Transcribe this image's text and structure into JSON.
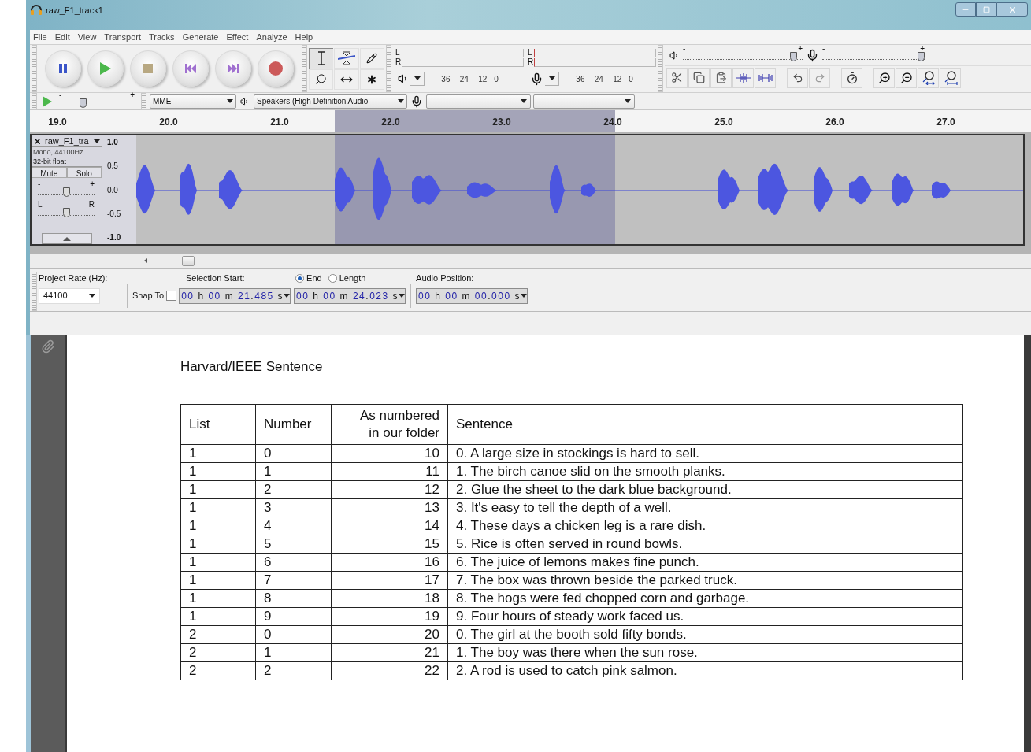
{
  "window": {
    "title": "raw_F1_track1"
  },
  "menu": [
    "File",
    "Edit",
    "View",
    "Transport",
    "Tracks",
    "Generate",
    "Effect",
    "Analyze",
    "Help"
  ],
  "tools": [
    {
      "kind": "select",
      "selected": true
    },
    {
      "kind": "envelope",
      "selected": false
    },
    {
      "kind": "draw",
      "selected": false
    },
    {
      "kind": "zoom",
      "selected": false
    },
    {
      "kind": "timeshift",
      "selected": false
    },
    {
      "kind": "multi",
      "selected": false
    }
  ],
  "meters": [
    {
      "kind": "playback",
      "channels": [
        "L",
        "R"
      ],
      "scale": [
        "-36",
        "-24",
        "-12",
        "0"
      ]
    },
    {
      "kind": "recording",
      "channels": [
        "L",
        "R"
      ],
      "scale": [
        "-36",
        "-24",
        "-12",
        "0"
      ]
    }
  ],
  "mixer": [
    {
      "kind": "output",
      "min": "-",
      "max": "+",
      "level": 0.95
    },
    {
      "kind": "input",
      "min": "-",
      "max": "+",
      "level": 1
    }
  ],
  "play_at_speed": {
    "min": "-",
    "max": "+",
    "level": 0.3
  },
  "devices": {
    "host": "MME",
    "output": "Speakers (High Definition Audio"
  },
  "ruler": [
    "19.0",
    "20.0",
    "21.0",
    "22.0",
    "23.0",
    "24.0",
    "25.0",
    "26.0",
    "27.0"
  ],
  "track": {
    "name": "raw_F1_tra",
    "format": "Mono, 44100Hz",
    "sample": "32-bit float",
    "mute": "Mute",
    "solo": "Solo",
    "gain": {
      "min": "-",
      "max": "+",
      "level": 0.5
    },
    "pan": {
      "min": "L",
      "max": "R",
      "level": 0.5
    },
    "scale": [
      "1.0",
      "0.5",
      "0.0",
      "-0.5",
      "-1.0"
    ]
  },
  "selection_bar": {
    "rate_label": "Project Rate (Hz):",
    "rate": "44100",
    "snap_label": "Snap To",
    "snap": false,
    "start_label": "Selection Start:",
    "modes": [
      {
        "label": "End",
        "selected": true
      },
      {
        "label": "Length",
        "selected": false
      }
    ],
    "start": "00 h 00 m 21.485 s",
    "end": "00 h 00 m 24.023 s",
    "position_label": "Audio Position:",
    "position": "00 h 00 m 00.000 s"
  },
  "document": {
    "heading": "Harvard/IEEE Sentence",
    "table": {
      "columns": [
        "List",
        "Number",
        "As numbered in our folder",
        "Sentence"
      ],
      "rows": [
        [
          "1",
          "0",
          "10",
          "0. A large size in stockings is hard to sell."
        ],
        [
          "1",
          "1",
          "11",
          "1. The birch canoe slid on the smooth planks."
        ],
        [
          "1",
          "2",
          "12",
          "2. Glue the sheet to the dark blue background."
        ],
        [
          "1",
          "3",
          "13",
          "3. It's easy to tell the depth of a well."
        ],
        [
          "1",
          "4",
          "14",
          "4. These days a chicken leg is a rare dish."
        ],
        [
          "1",
          "5",
          "15",
          "5. Rice is often served in round bowls."
        ],
        [
          "1",
          "6",
          "16",
          "6. The juice of lemons makes fine punch."
        ],
        [
          "1",
          "7",
          "17",
          "7. The box was thrown beside the parked truck."
        ],
        [
          "1",
          "8",
          "18",
          "8. The hogs were fed chopped corn and garbage."
        ],
        [
          "1",
          "9",
          "19",
          "9. Four hours of steady work faced us."
        ],
        [
          "2",
          "0",
          "20",
          "0. The girl at the booth sold fifty bonds."
        ],
        [
          "2",
          "1",
          "21",
          "1. The boy was there when the sun rose."
        ],
        [
          "2",
          "2",
          "22",
          "2. A rod is used to catch pink salmon."
        ]
      ]
    }
  }
}
